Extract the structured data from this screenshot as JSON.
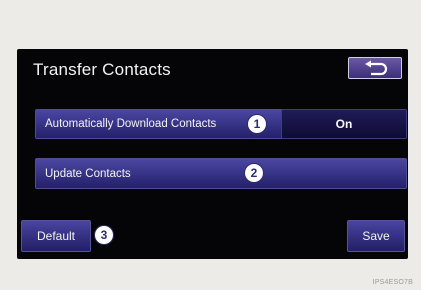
{
  "screen": {
    "title": "Transfer Contacts",
    "back_icon": "return-arrow-icon",
    "auto_download": {
      "label": "Automatically Download Contacts",
      "value": "On",
      "badge": "1"
    },
    "update_contacts": {
      "label": "Update Contacts",
      "badge": "2"
    },
    "default_button": {
      "label": "Default",
      "badge": "3"
    },
    "save_button": {
      "label": "Save"
    }
  },
  "figure_code": "IPS4ESO7B",
  "colors": {
    "screen_bg": "#050507",
    "button_gradient_top": "#4a45a0",
    "button_gradient_bottom": "#221e66",
    "badge_bg": "#ffffff"
  }
}
